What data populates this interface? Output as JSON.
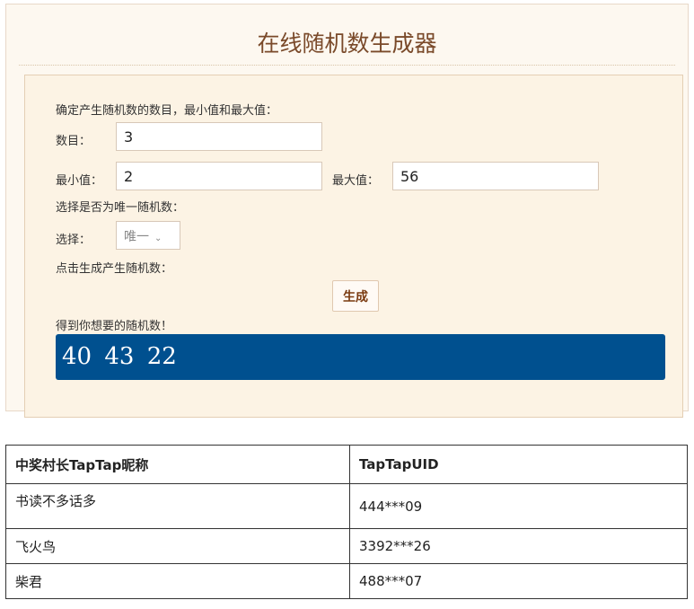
{
  "title": "在线随机数生成器",
  "form": {
    "intro": "确定产生随机数的数目，最小值和最大值：",
    "count_label": "数目：",
    "count_value": "3",
    "min_label": "最小值：",
    "min_value": "2",
    "max_label": "最大值：",
    "max_value": "56",
    "unique_prompt": "选择是否为唯一随机数：",
    "select_label": "选择：",
    "select_value": "唯一",
    "generate_prompt": "点击生成产生随机数：",
    "generate_button": "生成",
    "result_prompt": "得到你想要的随机数！",
    "result": "40  43  22"
  },
  "table": {
    "headers": [
      "中奖村长TapTap昵称",
      "TapTapUID"
    ],
    "rows": [
      [
        "书读不多话多",
        "444***09"
      ],
      [
        "飞火鸟",
        "3392***26"
      ],
      [
        "柴君",
        "488***07"
      ]
    ]
  }
}
